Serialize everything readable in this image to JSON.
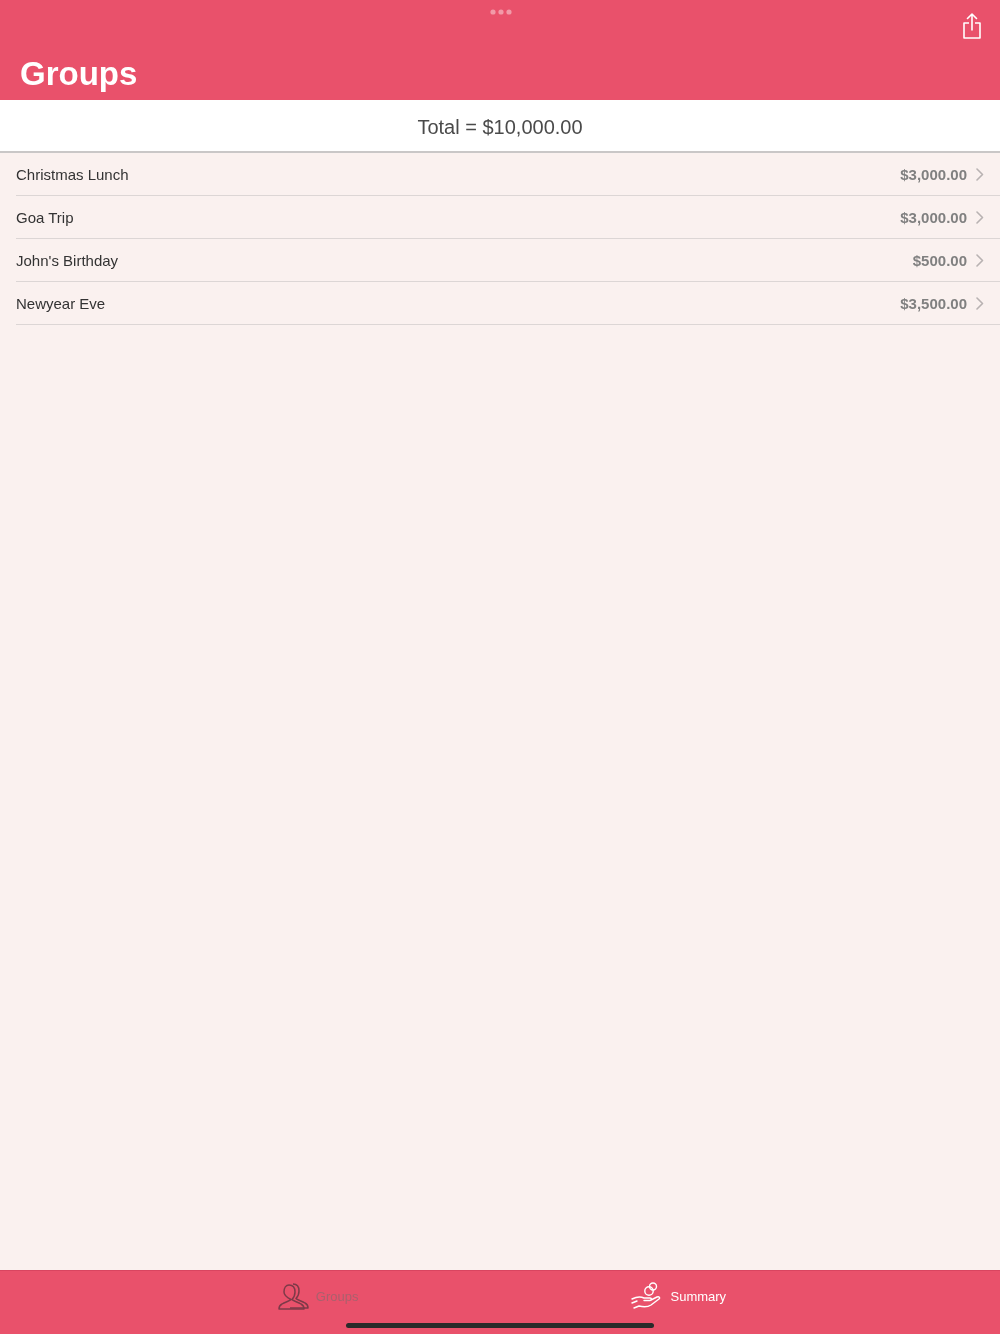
{
  "header": {
    "title": "Groups"
  },
  "total": "Total = $10,000.00",
  "groups": [
    {
      "name": "Christmas Lunch",
      "amount": "$3,000.00"
    },
    {
      "name": "Goa Trip",
      "amount": "$3,000.00"
    },
    {
      "name": "John's Birthday",
      "amount": "$500.00"
    },
    {
      "name": "Newyear Eve",
      "amount": "$3,500.00"
    }
  ],
  "tab_bar": {
    "tabs": [
      {
        "label": "Groups",
        "kind": "people",
        "selected": true
      },
      {
        "label": "Summary",
        "kind": "coins",
        "selected": false
      }
    ]
  }
}
